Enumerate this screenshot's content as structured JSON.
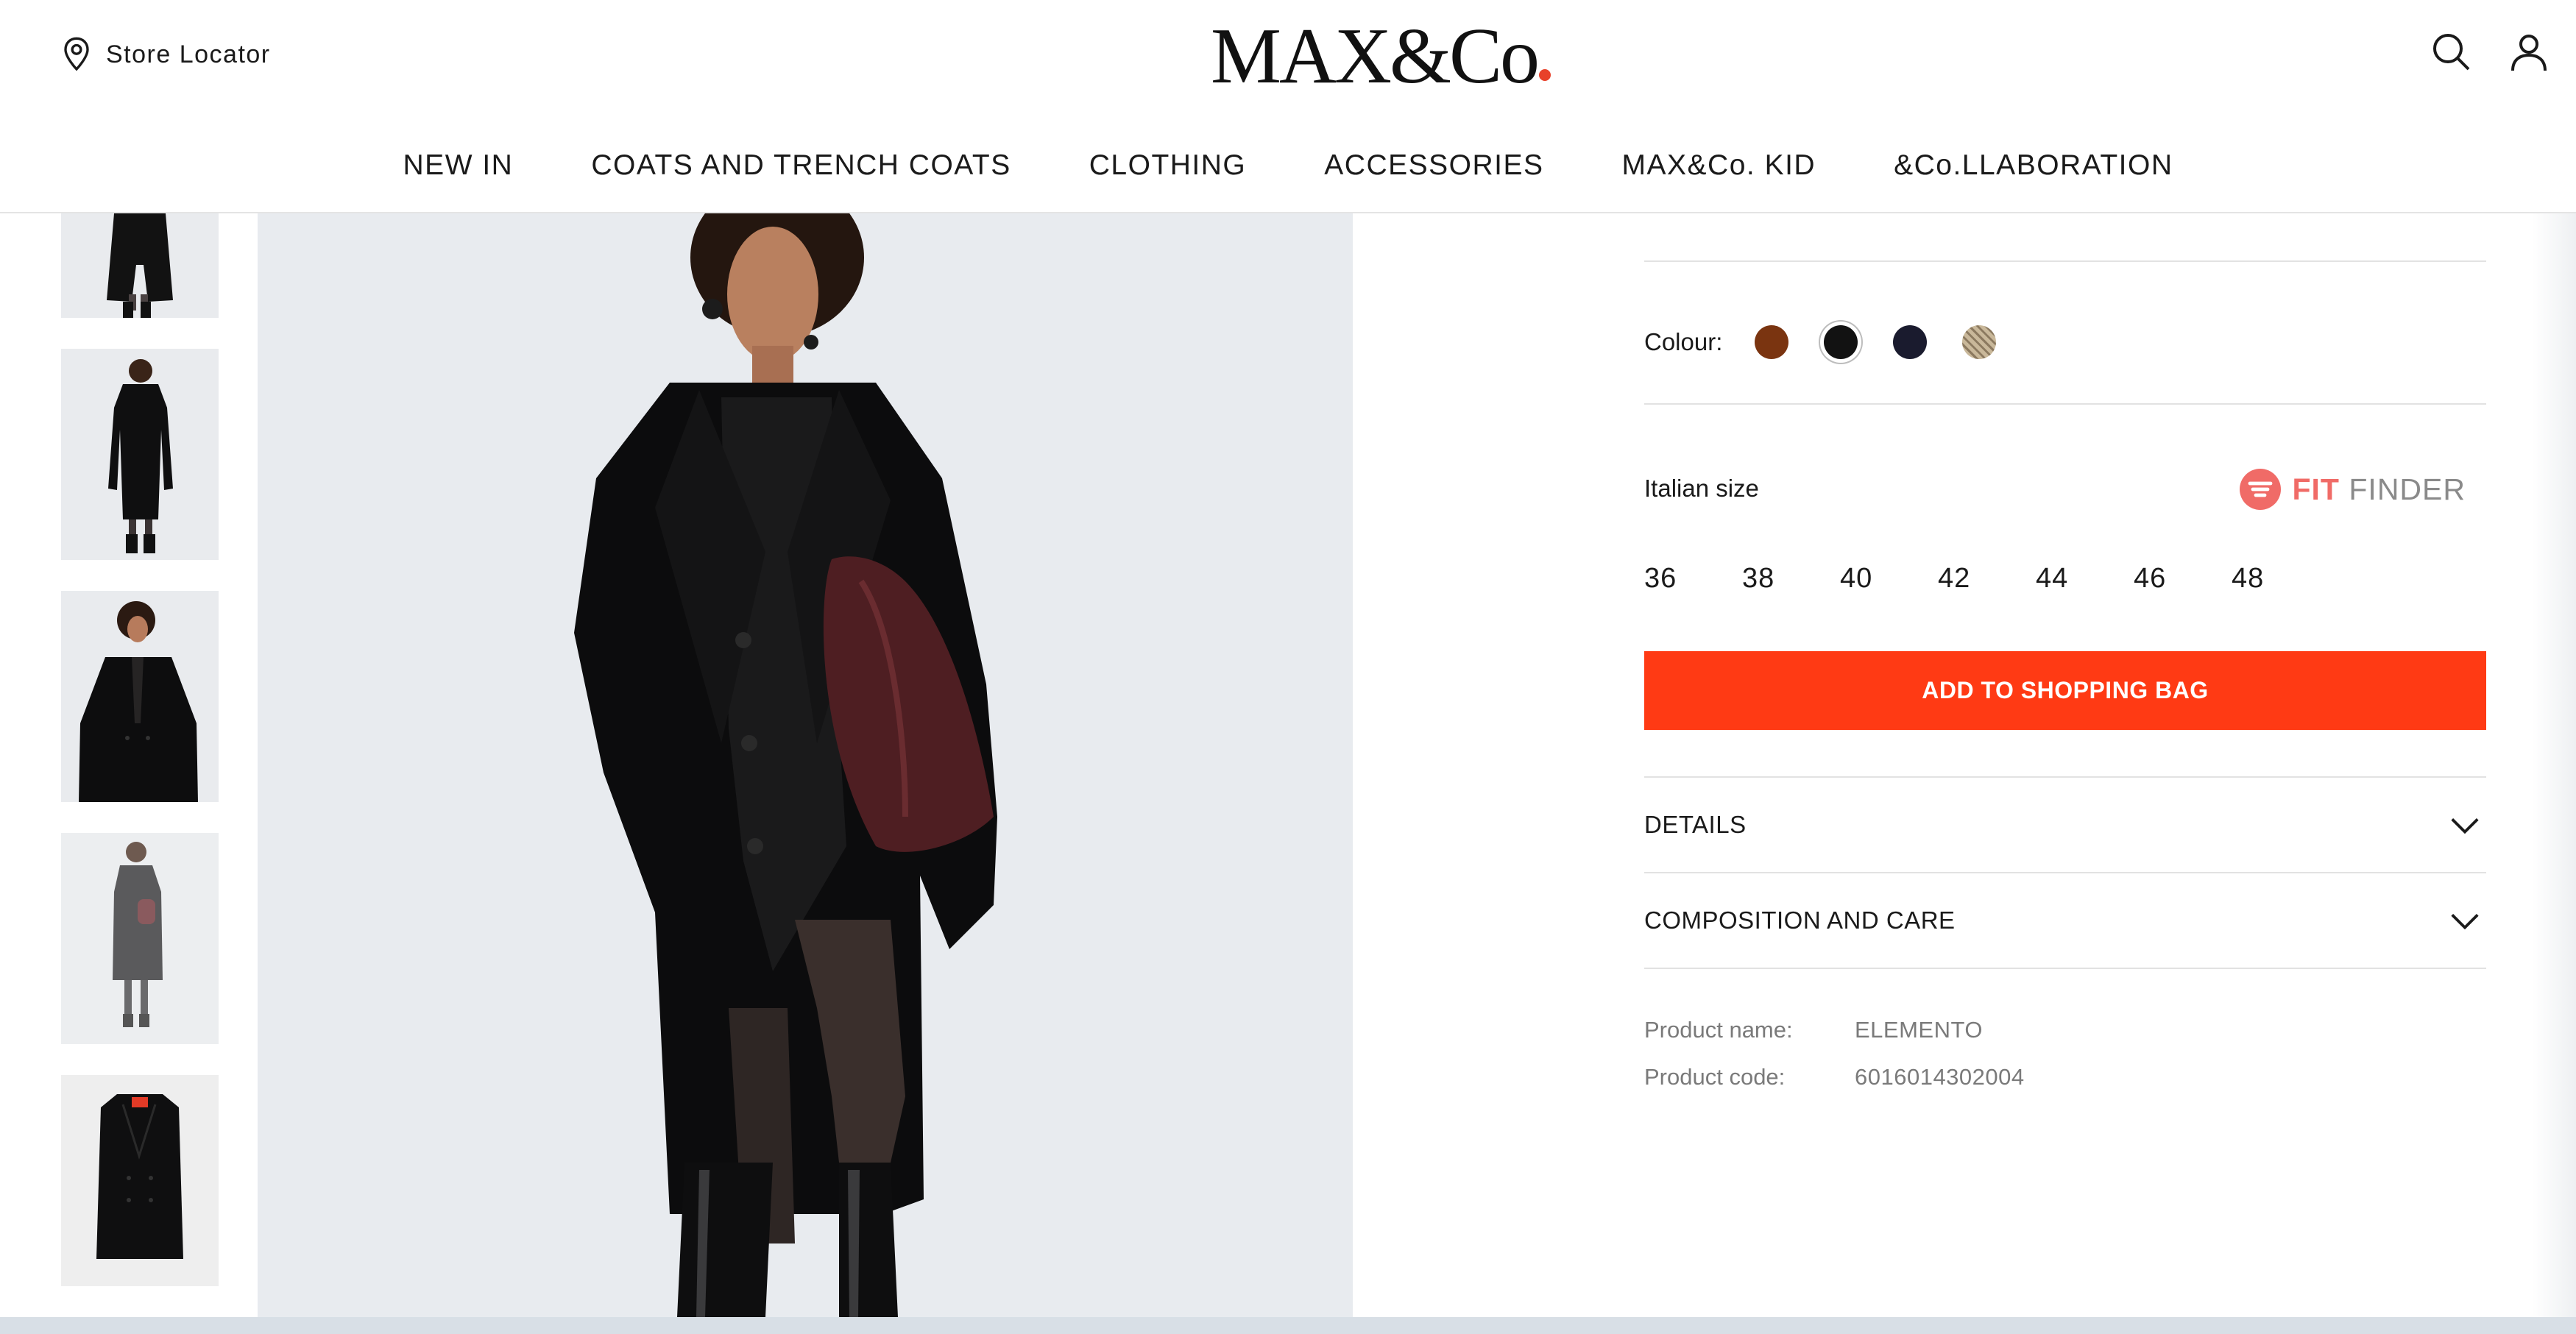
{
  "header": {
    "store_locator_label": "Store Locator",
    "logo_text": "MAX&Co",
    "icons": [
      "location-pin-icon",
      "search-icon",
      "account-icon"
    ]
  },
  "nav": {
    "items": [
      {
        "label": "NEW IN"
      },
      {
        "label": "COATS AND TRENCH COATS"
      },
      {
        "label": "CLOTHING"
      },
      {
        "label": "ACCESSORIES"
      },
      {
        "label": "MAX&Co. KID"
      },
      {
        "label": "&Co.LLABORATION"
      }
    ]
  },
  "product": {
    "colour_label": "Colour:",
    "colours": [
      {
        "name": "brown",
        "hex": "#7a3410",
        "selected": false
      },
      {
        "name": "black",
        "hex": "#121212",
        "selected": true
      },
      {
        "name": "navy",
        "hex": "#1a1b2e",
        "selected": false
      },
      {
        "name": "check",
        "hex": "#a8987e",
        "selected": false
      }
    ],
    "size_label": "Italian size",
    "fit_finder": {
      "fit": "FIT",
      "finder": "FINDER"
    },
    "sizes": [
      "36",
      "38",
      "40",
      "42",
      "44",
      "46",
      "48"
    ],
    "add_to_bag_label": "ADD TO SHOPPING BAG",
    "accordions": [
      {
        "label": "DETAILS"
      },
      {
        "label": "COMPOSITION AND CARE"
      }
    ],
    "info": {
      "name_key": "Product name:",
      "name_value": "ELEMENTO",
      "code_key": "Product code:",
      "code_value": "6016014302004"
    }
  },
  "colors": {
    "accent": "#ff3a14",
    "logo_dot": "#e8412a",
    "fit_finder": "#f06b67",
    "image_bg": "#e8ebef"
  }
}
